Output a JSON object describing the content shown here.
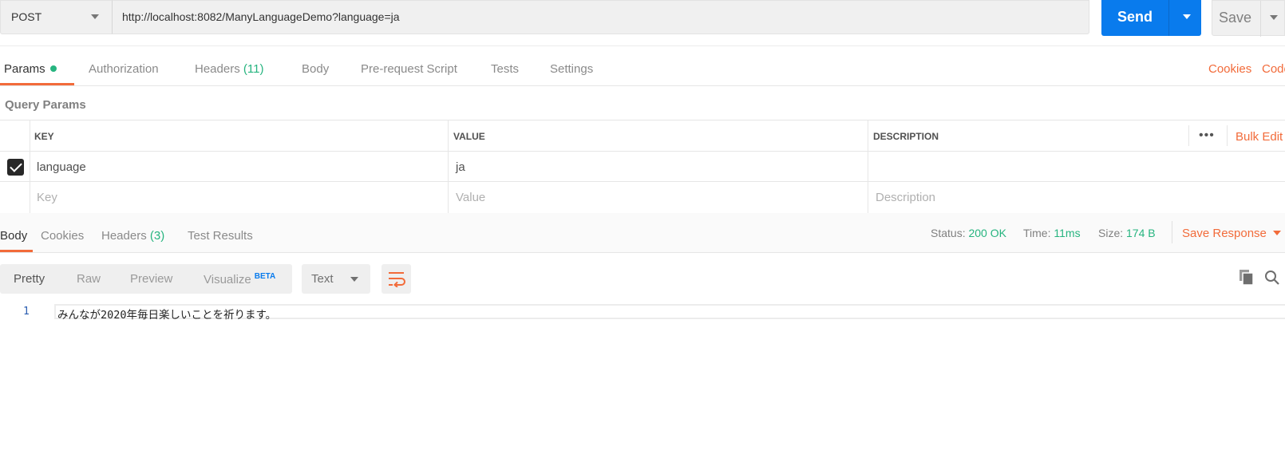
{
  "request": {
    "method": "POST",
    "url": "http://localhost:8082/ManyLanguageDemo?language=ja",
    "send_label": "Send",
    "save_label": "Save"
  },
  "request_tabs": {
    "params": "Params",
    "authorization": "Authorization",
    "headers": "Headers",
    "headers_count": "(11)",
    "body": "Body",
    "pre_request": "Pre-request Script",
    "tests": "Tests",
    "settings": "Settings",
    "cookies": "Cookies",
    "code": "Code"
  },
  "query_params": {
    "title": "Query Params",
    "columns": {
      "key": "KEY",
      "value": "VALUE",
      "description": "DESCRIPTION"
    },
    "more": "•••",
    "bulk_edit": "Bulk Edit",
    "rows": [
      {
        "checked": true,
        "key": "language",
        "value": "ja",
        "description": ""
      }
    ],
    "placeholders": {
      "key": "Key",
      "value": "Value",
      "description": "Description"
    }
  },
  "response": {
    "tabs": {
      "body": "Body",
      "cookies": "Cookies",
      "headers": "Headers",
      "headers_count": "(3)",
      "test_results": "Test Results"
    },
    "status_label": "Status:",
    "status_value": "200 OK",
    "time_label": "Time:",
    "time_value": "11ms",
    "size_label": "Size:",
    "size_value": "174 B",
    "save_response": "Save Response",
    "view_modes": {
      "pretty": "Pretty",
      "raw": "Raw",
      "preview": "Preview",
      "visualize": "Visualize",
      "beta": "BETA"
    },
    "format": "Text",
    "lines": [
      {
        "number": "1",
        "text": "みんなが2020年毎日楽しいことを祈ります。"
      }
    ]
  },
  "colors": {
    "accent": "#f26b3a",
    "primary": "#097bed",
    "success": "#26b47f"
  }
}
